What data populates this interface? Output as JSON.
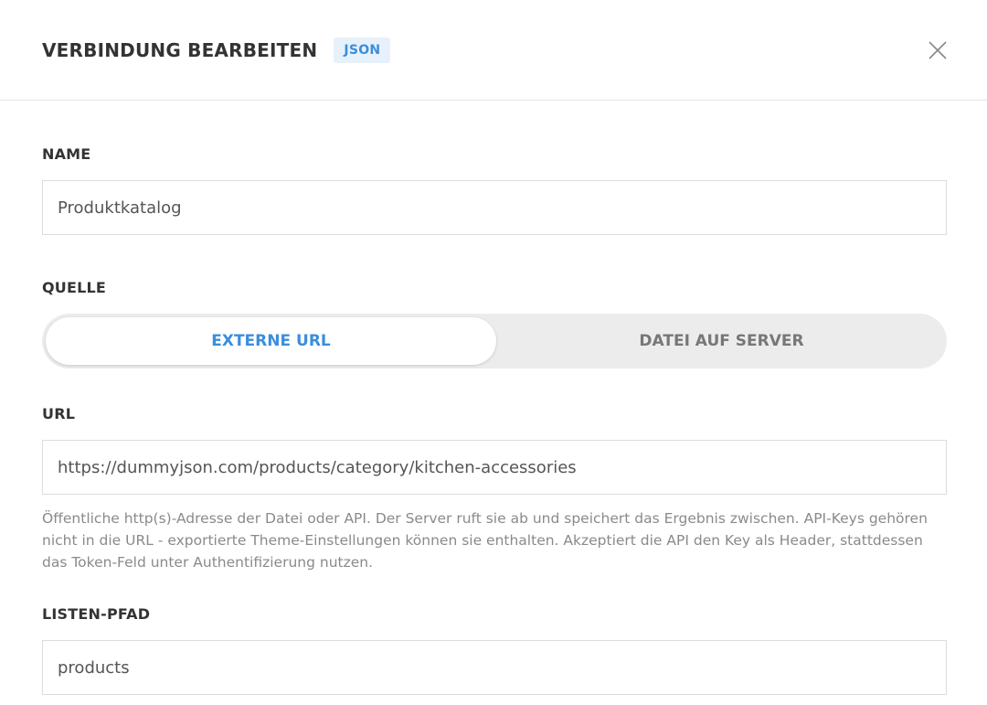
{
  "header": {
    "title": "VERBINDUNG BEARBEITEN",
    "badge": "JSON",
    "close_icon": "close-icon"
  },
  "form": {
    "name": {
      "label": "NAME",
      "value": "Produktkatalog"
    },
    "source": {
      "label": "QUELLE",
      "options": [
        "EXTERNE URL",
        "DATEI AUF SERVER"
      ],
      "selected": "EXTERNE URL"
    },
    "url": {
      "label": "URL",
      "value": "https://dummyjson.com/products/category/kitchen-accessories",
      "help": "Öffentliche http(s)-Adresse der Datei oder API. Der Server ruft sie ab und speichert das Ergebnis zwischen. API-Keys gehören nicht in die URL - exportierte Theme-Einstellungen können sie enthalten. Akzeptiert die API den Key als Header, stattdessen das Token-Feld unter Authentifizierung nutzen."
    },
    "list_path": {
      "label": "LISTEN-PFAD",
      "value": "products"
    }
  },
  "colors": {
    "accent": "#3a8edc",
    "badge_bg": "#e7f1fb",
    "toggle_bg": "#ececec",
    "border": "#dcdcdc"
  }
}
